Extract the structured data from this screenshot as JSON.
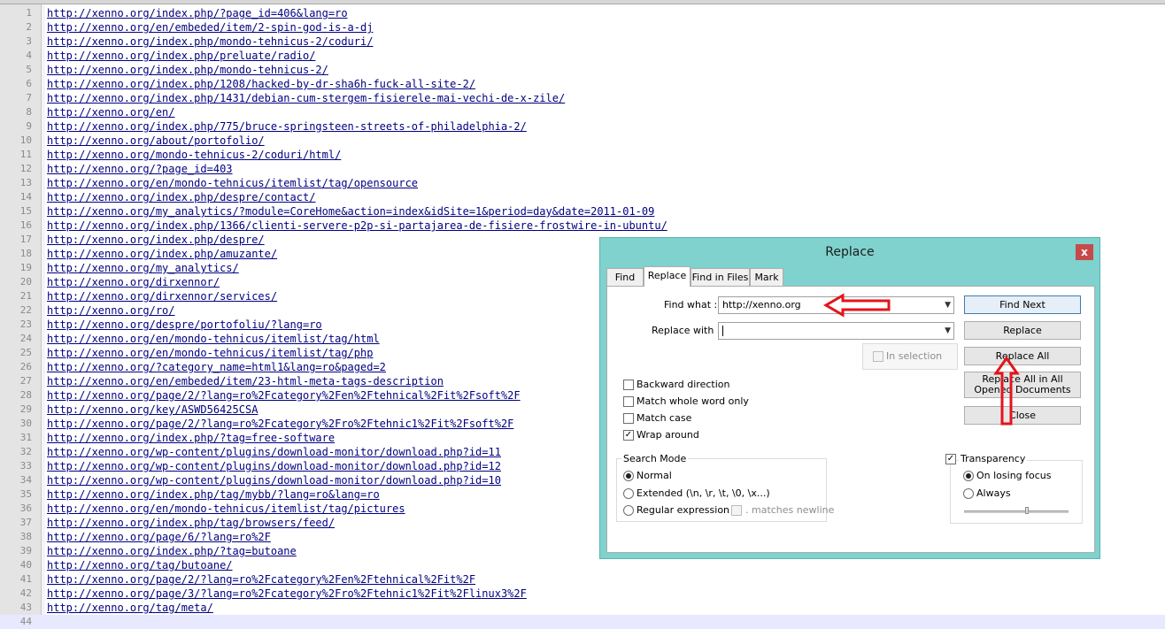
{
  "editor": {
    "lines": [
      "http://xenno.org/index.php/?page_id=406&lang=ro",
      "http://xenno.org/en/embeded/item/2-spin-god-is-a-dj",
      "http://xenno.org/index.php/mondo-tehnicus-2/coduri/",
      "http://xenno.org/index.php/preluate/radio/",
      "http://xenno.org/index.php/mondo-tehnicus-2/",
      "http://xenno.org/index.php/1208/hacked-by-dr-sha6h-fuck-all-site-2/",
      "http://xenno.org/index.php/1431/debian-cum-stergem-fisierele-mai-vechi-de-x-zile/",
      "http://xenno.org/en/",
      "http://xenno.org/index.php/775/bruce-springsteen-streets-of-philadelphia-2/",
      "http://xenno.org/about/portofolio/",
      "http://xenno.org/mondo-tehnicus-2/coduri/html/",
      "http://xenno.org/?page_id=403",
      "http://xenno.org/en/mondo-tehnicus/itemlist/tag/opensource",
      "http://xenno.org/index.php/despre/contact/",
      "http://xenno.org/my_analytics/?module=CoreHome&action=index&idSite=1&period=day&date=2011-01-09",
      "http://xenno.org/index.php/1366/clienti-servere-p2p-si-partajarea-de-fisiere-frostwire-in-ubuntu/",
      "http://xenno.org/index.php/despre/",
      "http://xenno.org/index.php/amuzante/",
      "http://xenno.org/my_analytics/",
      "http://xenno.org/dirxennor/",
      "http://xenno.org/dirxennor/services/",
      "http://xenno.org/ro/",
      "http://xenno.org/despre/portofoliu/?lang=ro",
      "http://xenno.org/en/mondo-tehnicus/itemlist/tag/html",
      "http://xenno.org/en/mondo-tehnicus/itemlist/tag/php",
      "http://xenno.org/?category_name=html1&lang=ro&paged=2",
      "http://xenno.org/en/embeded/item/23-html-meta-tags-description",
      "http://xenno.org/page/2/?lang=ro%2Fcategory%2Fen%2Ftehnical%2Fit%2Fsoft%2F",
      "http://xenno.org/key/ASWD56425CSA",
      "http://xenno.org/page/2/?lang=ro%2Fcategory%2Fro%2Ftehnic1%2Fit%2Fsoft%2F",
      "http://xenno.org/index.php/?tag=free-software",
      "http://xenno.org/wp-content/plugins/download-monitor/download.php?id=11",
      "http://xenno.org/wp-content/plugins/download-monitor/download.php?id=12",
      "http://xenno.org/wp-content/plugins/download-monitor/download.php?id=10",
      "http://xenno.org/index.php/tag/mybb/?lang=ro&lang=ro",
      "http://xenno.org/en/mondo-tehnicus/itemlist/tag/pictures",
      "http://xenno.org/index.php/tag/browsers/feed/",
      "http://xenno.org/page/6/?lang=ro%2F",
      "http://xenno.org/index.php/?tag=butoane",
      "http://xenno.org/tag/butoane/",
      "http://xenno.org/page/2/?lang=ro%2Fcategory%2Fen%2Ftehnical%2Fit%2F",
      "http://xenno.org/page/3/?lang=ro%2Fcategory%2Fro%2Ftehnic1%2Fit%2Flinux3%2F",
      "http://xenno.org/tag/meta/",
      ""
    ]
  },
  "dialog": {
    "title": "Replace",
    "close_glyph": "x",
    "tabs": [
      "Find",
      "Replace",
      "Find in Files",
      "Mark"
    ],
    "active_tab": "Replace",
    "find_label": "Find what :",
    "find_value": "http://xenno.org",
    "replace_label": "Replace with :",
    "replace_value": "",
    "in_selection_label": "In selection",
    "buttons": {
      "find_next": "Find Next",
      "replace": "Replace",
      "replace_all": "Replace All",
      "replace_all_opened": "Replace All in All Opened Documents",
      "close": "Close"
    },
    "options": [
      {
        "label": "Backward direction",
        "checked": false
      },
      {
        "label": "Match whole word only",
        "checked": false
      },
      {
        "label": "Match case",
        "checked": false
      },
      {
        "label": "Wrap around",
        "checked": true
      }
    ],
    "search_mode": {
      "title": "Search Mode",
      "options": [
        "Normal",
        "Extended (\\n, \\r, \\t, \\0, \\x...)",
        "Regular expression"
      ],
      "selected": "Normal",
      "matches_newline_label": ". matches newline"
    },
    "transparency": {
      "label": "Transparency",
      "checked": true,
      "options": [
        "On losing focus",
        "Always"
      ],
      "selected": "On losing focus",
      "level": 0.6
    }
  },
  "colors": {
    "dialog_frame": "#7fd2ce",
    "annotation_arrow": "#e4141a",
    "link_text": "#000080"
  }
}
